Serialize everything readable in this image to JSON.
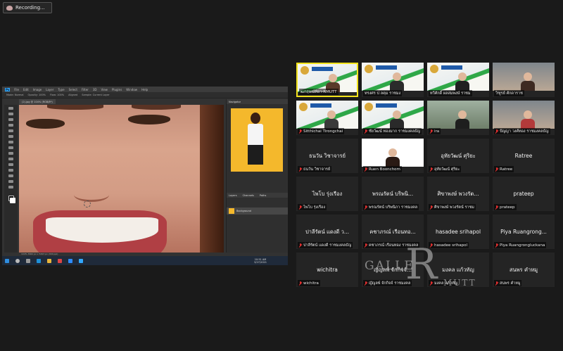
{
  "recording": {
    "label": "Recording..."
  },
  "photoshop": {
    "menu": [
      "Ps",
      "File",
      "Edit",
      "Image",
      "Layer",
      "Type",
      "Select",
      "Filter",
      "3D",
      "View",
      "Plugins",
      "Window",
      "Help"
    ],
    "options": [
      "Mode: Normal",
      "Opacity: 100%",
      "Flow: 100%",
      "Aligned",
      "Sample: Current Layer"
    ],
    "doc_tab": "(2).jpg @ 104% (RGB/8*)",
    "status": "104%   3662 px x 5493 px (300 ppi)",
    "panel_title": "Navigator",
    "layers_tabs": [
      "Layers",
      "Channels",
      "Paths"
    ],
    "layer_name": "Background",
    "clock": "10:51 AM",
    "date": "3/27/2021"
  },
  "participants": [
    {
      "label": "ฒกฤษณ์ทิยา-RMUTT",
      "video": "banner",
      "muted": false,
      "active": true,
      "person": "#5a3a2a"
    },
    {
      "label": "ทรงศร ป ลคุม ราชมง",
      "video": "banner",
      "muted": false,
      "active": false,
      "person": "#2b2b2b"
    },
    {
      "label": "ทวีศักดิ์ ผลสมพงษ์ ราชม",
      "video": "banner",
      "muted": false,
      "active": false,
      "person": "#202020"
    },
    {
      "label": "วิฑูรย์ ศักดาราช",
      "video": "room",
      "muted": false,
      "active": false,
      "person": "#3d2a22"
    },
    {
      "label": "Sitthichai Tirongchai",
      "video": "banner",
      "muted": true,
      "active": false,
      "person": "#3a3a3a"
    },
    {
      "label": "ชัยวัฒน์ ทองมาก ราชมงคลธัญ",
      "video": "banner",
      "muted": true,
      "active": false,
      "person": "#2a2a2a"
    },
    {
      "label": "ira",
      "video": "outdoor",
      "muted": true,
      "active": false,
      "person": "#1e1e1e"
    },
    {
      "label": "ปัญญา วงศ์ทอง ราชมงคลธัญ",
      "video": "room",
      "muted": true,
      "active": false,
      "person": "#b33a3a"
    },
    {
      "name": "ธนวัน วิชาจารย์",
      "label": "ธนวัน วิชาจารย์",
      "muted": true
    },
    {
      "label": "Ruen Boonchom",
      "video": "face",
      "muted": true,
      "active": false,
      "person": "#2a1a14"
    },
    {
      "name": "อุทัยวัฒน์ ศุริยะ",
      "label": "อุทัยวัฒน์ ศุริยะ",
      "muted": true
    },
    {
      "name": "Ratree",
      "label": "Ratree",
      "muted": true
    },
    {
      "name": "ไพโบ รุ่งเรือง",
      "label": "ไพโบ รุ่งเรือง",
      "muted": true
    },
    {
      "name": "พรณรัตน์ บริพนิ...",
      "label": "พรณรัตน์ บริพนิภา ราชมงคล",
      "muted": true
    },
    {
      "name": "ศิขาพงษ์ พวงรัต...",
      "label": "ศิขาพงษ์ พวงรัตน์ ราชม",
      "muted": true
    },
    {
      "name": "prateep",
      "label": "prateep",
      "muted": true
    },
    {
      "name": "ปาลีรัตน์ แดงดี ว...",
      "label": "ปาลีรัตน์ แดงดี ราชมงคลธัญ",
      "muted": true
    },
    {
      "name": "คชาภรณ์ เรือนทอ...",
      "label": "คชาภรณ์ เรือนทอง ราชมงคล",
      "muted": true
    },
    {
      "name": "hasadee srihapol",
      "label": "hasadee srihapol",
      "muted": true
    },
    {
      "name": "Piya Ruangrong...",
      "label": "Piya Ruangrongluckana",
      "muted": true
    },
    {
      "name": "wichitra",
      "label": "wichitra",
      "muted": true
    },
    {
      "name": "ญัญลพ์ จักกิจจ์...",
      "label": "ญัญลพ์ จักกิจจ์ ราชมงคล",
      "muted": true
    },
    {
      "name": "มงคล แก้วทัญ",
      "label": "มงคล แก้วทัญ",
      "muted": true
    },
    {
      "name": "สนพร คำหมู",
      "label": "สนพร คำหมู",
      "muted": true
    }
  ],
  "watermark": {
    "left": "GALLE",
    "big": "R",
    "right": "MUTT"
  },
  "colors": {
    "active_border": "#f2e21b",
    "mic_muted": "#e02f2f",
    "background": "#1a1a1a"
  }
}
